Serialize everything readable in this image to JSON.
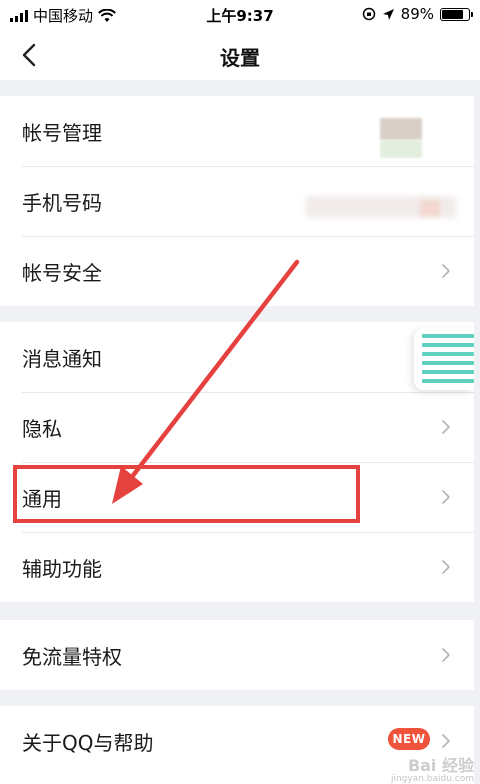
{
  "status_bar": {
    "carrier": "中国移动",
    "time": "上午9:37",
    "battery_percent": "89%",
    "battery_level": 0.89
  },
  "nav": {
    "title": "设置",
    "back_icon": "chevron-left-icon"
  },
  "groups": [
    {
      "items": [
        {
          "label": "帐号管理",
          "chevron": false
        },
        {
          "label": "手机号码",
          "chevron": false
        },
        {
          "label": "帐号安全",
          "chevron": true
        }
      ]
    },
    {
      "items": [
        {
          "label": "消息通知",
          "chevron": false
        },
        {
          "label": "隐私",
          "chevron": true
        },
        {
          "label": "通用",
          "chevron": true,
          "highlighted": true
        },
        {
          "label": "辅助功能",
          "chevron": true
        }
      ]
    },
    {
      "items": [
        {
          "label": "免流量特权",
          "chevron": true
        }
      ]
    },
    {
      "items": [
        {
          "label": "关于QQ与帮助",
          "chevron": true,
          "badge": "NEW"
        }
      ]
    }
  ],
  "watermark": {
    "text": "Bai 经验",
    "sub": "jingyan.baidu.com"
  },
  "colors": {
    "highlight": "#e5413f",
    "badge": "#f0533c",
    "menu_icon_lines": "#5fcfc0"
  }
}
